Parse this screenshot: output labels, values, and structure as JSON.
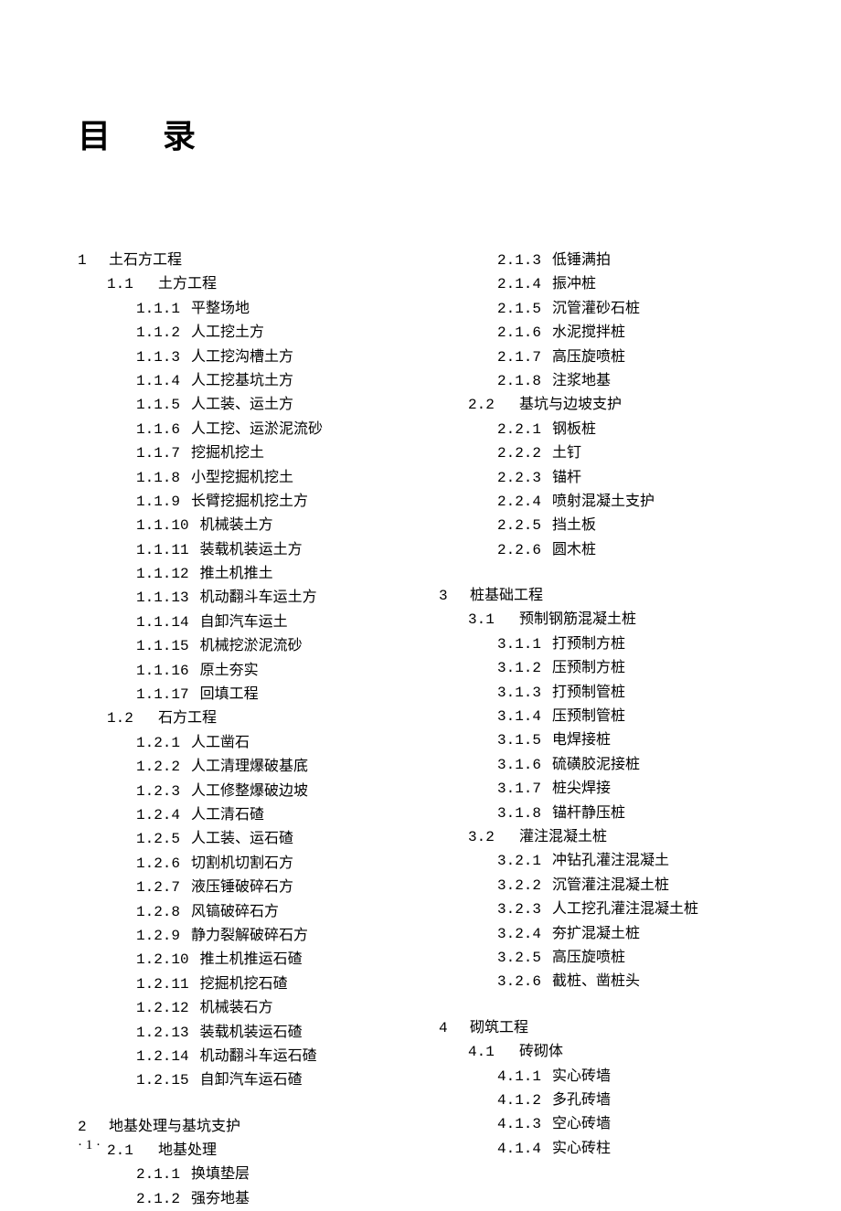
{
  "title": "目 录",
  "page_number": "· 1 ·",
  "toc": [
    {
      "level": "chapter",
      "num": "1",
      "title": "土石方工程"
    },
    {
      "level": "section",
      "num": "1.1",
      "title": "土方工程"
    },
    {
      "level": "item",
      "num": "1.1.1",
      "title": "平整场地"
    },
    {
      "level": "item",
      "num": "1.1.2",
      "title": "人工挖土方"
    },
    {
      "level": "item",
      "num": "1.1.3",
      "title": "人工挖沟槽土方"
    },
    {
      "level": "item",
      "num": "1.1.4",
      "title": "人工挖基坑土方"
    },
    {
      "level": "item",
      "num": "1.1.5",
      "title": "人工装、运土方"
    },
    {
      "level": "item",
      "num": "1.1.6",
      "title": "人工挖、运淤泥流砂"
    },
    {
      "level": "item",
      "num": "1.1.7",
      "title": "挖掘机挖土"
    },
    {
      "level": "item",
      "num": "1.1.8",
      "title": "小型挖掘机挖土"
    },
    {
      "level": "item",
      "num": "1.1.9",
      "title": "长臂挖掘机挖土方"
    },
    {
      "level": "item",
      "num": "1.1.10",
      "title": "机械装土方"
    },
    {
      "level": "item",
      "num": "1.1.11",
      "title": "装载机装运土方"
    },
    {
      "level": "item",
      "num": "1.1.12",
      "title": "推土机推土"
    },
    {
      "level": "item",
      "num": "1.1.13",
      "title": "机动翻斗车运土方"
    },
    {
      "level": "item",
      "num": "1.1.14",
      "title": "自卸汽车运土"
    },
    {
      "level": "item",
      "num": "1.1.15",
      "title": "机械挖淤泥流砂"
    },
    {
      "level": "item",
      "num": "1.1.16",
      "title": "原土夯实"
    },
    {
      "level": "item",
      "num": "1.1.17",
      "title": "回填工程"
    },
    {
      "level": "section",
      "num": "1.2",
      "title": "石方工程"
    },
    {
      "level": "item",
      "num": "1.2.1",
      "title": "人工凿石"
    },
    {
      "level": "item",
      "num": "1.2.2",
      "title": "人工清理爆破基底"
    },
    {
      "level": "item",
      "num": "1.2.3",
      "title": "人工修整爆破边坡"
    },
    {
      "level": "item",
      "num": "1.2.4",
      "title": "人工清石碴"
    },
    {
      "level": "item",
      "num": "1.2.5",
      "title": "人工装、运石碴"
    },
    {
      "level": "item",
      "num": "1.2.6",
      "title": "切割机切割石方"
    },
    {
      "level": "item",
      "num": "1.2.7",
      "title": "液压锤破碎石方"
    },
    {
      "level": "item",
      "num": "1.2.8",
      "title": "风镐破碎石方"
    },
    {
      "level": "item",
      "num": "1.2.9",
      "title": "静力裂解破碎石方"
    },
    {
      "level": "item",
      "num": "1.2.10",
      "title": "推土机推运石碴"
    },
    {
      "level": "item",
      "num": "1.2.11",
      "title": "挖掘机挖石碴"
    },
    {
      "level": "item",
      "num": "1.2.12",
      "title": "机械装石方"
    },
    {
      "level": "item",
      "num": "1.2.13",
      "title": "装载机装运石碴"
    },
    {
      "level": "item",
      "num": "1.2.14",
      "title": "机动翻斗车运石碴"
    },
    {
      "level": "item",
      "num": "1.2.15",
      "title": "自卸汽车运石碴"
    },
    {
      "level": "spacer"
    },
    {
      "level": "chapter",
      "num": "2",
      "title": "地基处理与基坑支护"
    },
    {
      "level": "section",
      "num": "2.1",
      "title": "地基处理"
    },
    {
      "level": "item",
      "num": "2.1.1",
      "title": "换填垫层"
    },
    {
      "level": "item",
      "num": "2.1.2",
      "title": "强夯地基",
      "col": 2
    },
    {
      "level": "item",
      "num": "2.1.3",
      "title": "低锤满拍"
    },
    {
      "level": "item",
      "num": "2.1.4",
      "title": "振冲桩"
    },
    {
      "level": "item",
      "num": "2.1.5",
      "title": "沉管灌砂石桩"
    },
    {
      "level": "item",
      "num": "2.1.6",
      "title": "水泥搅拌桩"
    },
    {
      "level": "item",
      "num": "2.1.7",
      "title": "高压旋喷桩"
    },
    {
      "level": "item",
      "num": "2.1.8",
      "title": "注浆地基"
    },
    {
      "level": "section",
      "num": "2.2",
      "title": "基坑与边坡支护"
    },
    {
      "level": "item",
      "num": "2.2.1",
      "title": "钢板桩"
    },
    {
      "level": "item",
      "num": "2.2.2",
      "title": "土钉"
    },
    {
      "level": "item",
      "num": "2.2.3",
      "title": "锚杆"
    },
    {
      "level": "item",
      "num": "2.2.4",
      "title": "喷射混凝土支护"
    },
    {
      "level": "item",
      "num": "2.2.5",
      "title": "挡土板"
    },
    {
      "level": "item",
      "num": "2.2.6",
      "title": "圆木桩"
    },
    {
      "level": "spacer"
    },
    {
      "level": "chapter",
      "num": "3",
      "title": "桩基础工程"
    },
    {
      "level": "section",
      "num": "3.1",
      "title": "预制钢筋混凝土桩"
    },
    {
      "level": "item",
      "num": "3.1.1",
      "title": "打预制方桩"
    },
    {
      "level": "item",
      "num": "3.1.2",
      "title": "压预制方桩"
    },
    {
      "level": "item",
      "num": "3.1.3",
      "title": "打预制管桩"
    },
    {
      "level": "item",
      "num": "3.1.4",
      "title": "压预制管桩"
    },
    {
      "level": "item",
      "num": "3.1.5",
      "title": "电焊接桩"
    },
    {
      "level": "item",
      "num": "3.1.6",
      "title": "硫磺胶泥接桩"
    },
    {
      "level": "item",
      "num": "3.1.7",
      "title": "桩尖焊接"
    },
    {
      "level": "item",
      "num": "3.1.8",
      "title": "锚杆静压桩"
    },
    {
      "level": "section",
      "num": "3.2",
      "title": "灌注混凝土桩"
    },
    {
      "level": "item",
      "num": "3.2.1",
      "title": "冲钻孔灌注混凝土"
    },
    {
      "level": "item",
      "num": "3.2.2",
      "title": "沉管灌注混凝土桩"
    },
    {
      "level": "item",
      "num": "3.2.3",
      "title": "人工挖孔灌注混凝土桩"
    },
    {
      "level": "item",
      "num": "3.2.4",
      "title": "夯扩混凝土桩"
    },
    {
      "level": "item",
      "num": "3.2.5",
      "title": "高压旋喷桩"
    },
    {
      "level": "item",
      "num": "3.2.6",
      "title": "截桩、凿桩头"
    },
    {
      "level": "spacer"
    },
    {
      "level": "chapter",
      "num": "4",
      "title": "砌筑工程"
    },
    {
      "level": "section",
      "num": "4.1",
      "title": "砖砌体"
    },
    {
      "level": "item",
      "num": "4.1.1",
      "title": "实心砖墙"
    },
    {
      "level": "item",
      "num": "4.1.2",
      "title": "多孔砖墙"
    },
    {
      "level": "item",
      "num": "4.1.3",
      "title": "空心砖墙"
    },
    {
      "level": "item",
      "num": "4.1.4",
      "title": "实心砖柱"
    }
  ],
  "col_break_index": 40
}
